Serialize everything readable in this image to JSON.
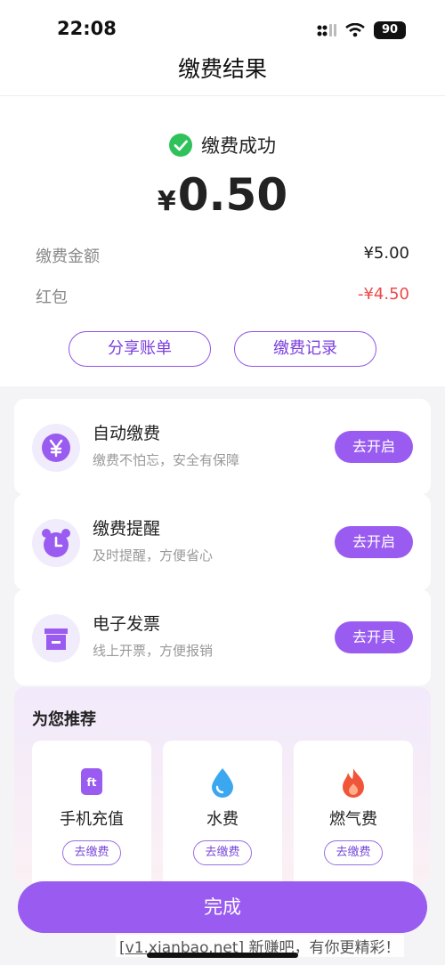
{
  "status_bar": {
    "time": "22:08",
    "battery": "90"
  },
  "nav": {
    "title": "缴费结果"
  },
  "result": {
    "status_text": "缴费成功",
    "currency_symbol": "¥",
    "amount": "0.50",
    "details": [
      {
        "label": "缴费金额",
        "value": "¥5.00",
        "color": "#222222"
      },
      {
        "label": "红包",
        "value": "-¥4.50",
        "color": "#f04848"
      }
    ],
    "share_label": "分享账单",
    "records_label": "缴费记录"
  },
  "services": [
    {
      "title": "自动缴费",
      "subtitle": "缴费不怕忘，安全有保障",
      "button": "去开启",
      "icon": "yen-icon"
    },
    {
      "title": "缴费提醒",
      "subtitle": "及时提醒，方便省心",
      "button": "去开启",
      "icon": "alarm-clock-icon"
    },
    {
      "title": "电子发票",
      "subtitle": "线上开票，方便报销",
      "button": "去开具",
      "icon": "invoice-icon"
    }
  ],
  "recommend": {
    "title": "为您推荐",
    "items": [
      {
        "label": "手机充值",
        "button": "去缴费",
        "icon": "phone-icon"
      },
      {
        "label": "水费",
        "button": "去缴费",
        "icon": "water-drop-icon"
      },
      {
        "label": "燃气费",
        "button": "去缴费",
        "icon": "flame-icon"
      }
    ]
  },
  "done_label": "完成",
  "watermark": {
    "link": "[v1.xianbao.net]",
    "text": " 新赚吧，有你更精彩！"
  },
  "colors": {
    "accent": "#9a5cf0",
    "success": "#2fc25b",
    "discount": "#f04848"
  }
}
